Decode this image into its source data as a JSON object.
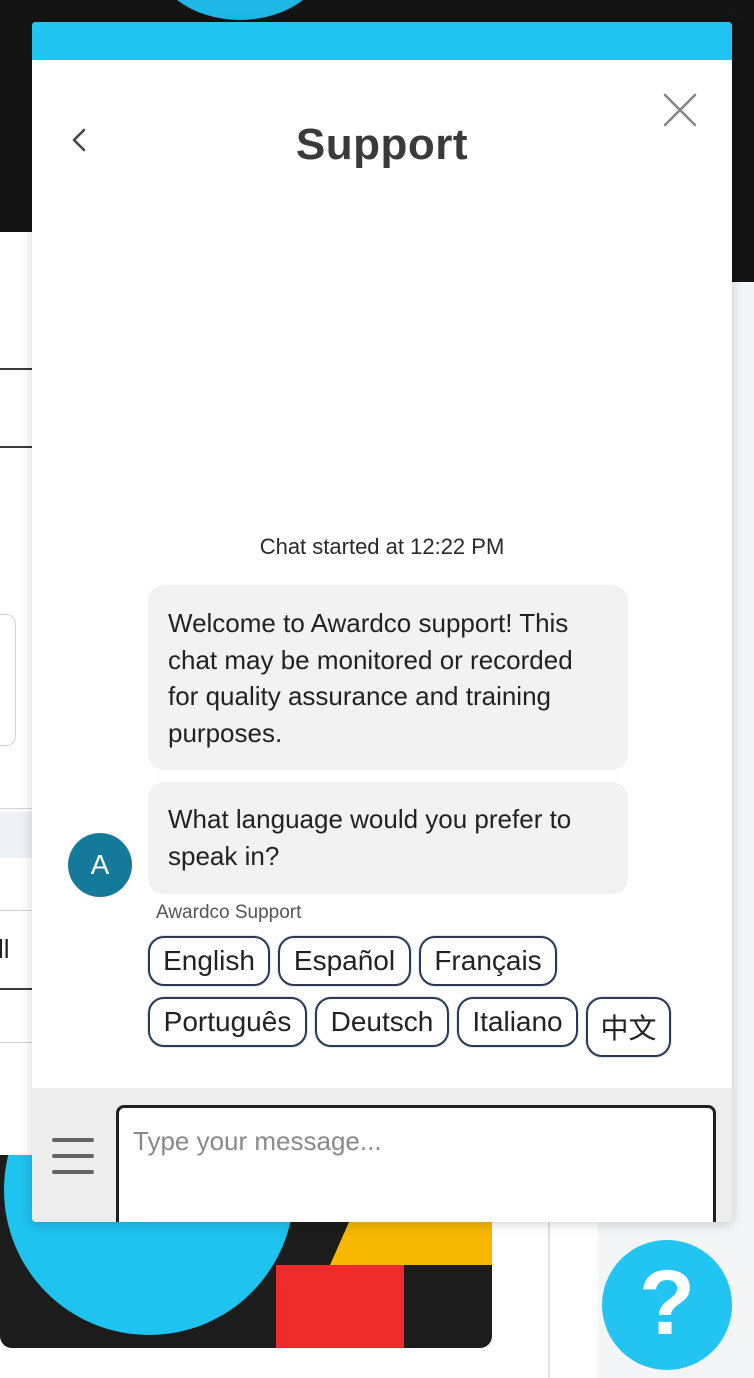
{
  "chat": {
    "title": "Support",
    "chat_started": "Chat started at 12:22 PM",
    "messages": [
      {
        "text": "Welcome to Awardco support! This chat may be monitored or recorded for quality assurance and training purposes."
      },
      {
        "text": "What language would you prefer to speak in?"
      }
    ],
    "avatar_initial": "A",
    "sender_name": "Awardco Support",
    "language_options": [
      "English",
      "Español",
      "Français",
      "Português",
      "Deutsch",
      "Italiano",
      "中文"
    ],
    "input": {
      "value": "",
      "placeholder": "Type your message..."
    }
  },
  "background": {
    "left_partial_text": "ll"
  },
  "help_button": {
    "label": "?"
  },
  "icons": {
    "back": "chevron-left-icon",
    "close": "close-icon",
    "menu": "hamburger-menu-icon"
  },
  "colors": {
    "accent": "#22c4f2",
    "avatar": "#157a9a",
    "bubble": "#f2f2f2",
    "title_text": "#3a3a3a"
  }
}
